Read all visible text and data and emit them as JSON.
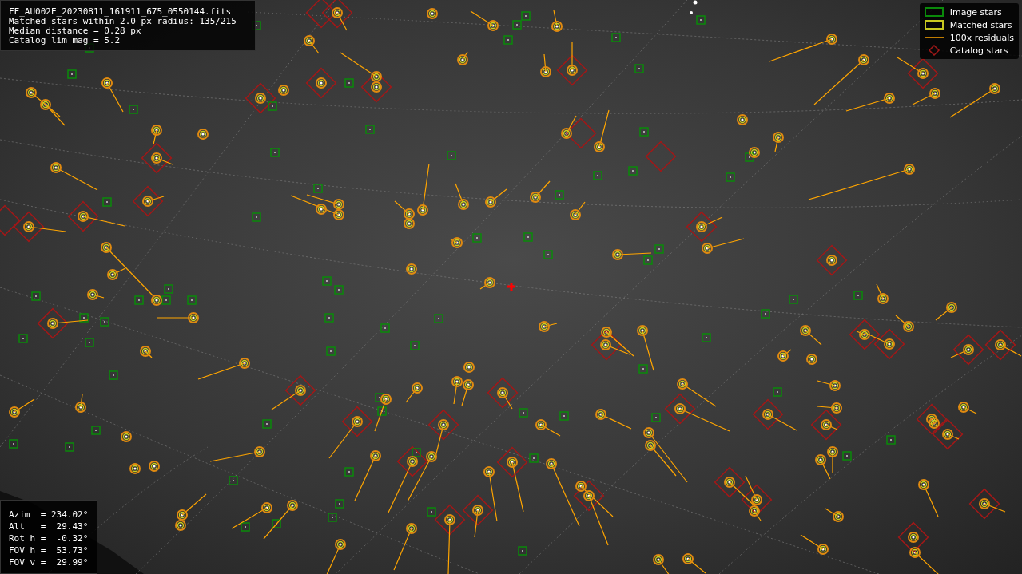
{
  "info": [
    "FF_AU002E_20230811_161911_675_0550144.fits",
    "Matched stars within 2.0 px radius: 135/215",
    "Median distance = 0.28 px",
    "Catalog lim mag = 5.2"
  ],
  "legend": [
    {
      "kind": "image",
      "label": "Image stars"
    },
    {
      "kind": "matched",
      "label": "Matched stars"
    },
    {
      "kind": "residual",
      "label": "100x residuals"
    },
    {
      "kind": "catalog",
      "label": "Catalog stars"
    }
  ],
  "pointing": [
    "Azim  = 234.02°",
    "Alt   =  29.43°",
    "Rot h =  -0.32°",
    "FOV h =  53.73°",
    "FOV v =  29.99°"
  ]
}
